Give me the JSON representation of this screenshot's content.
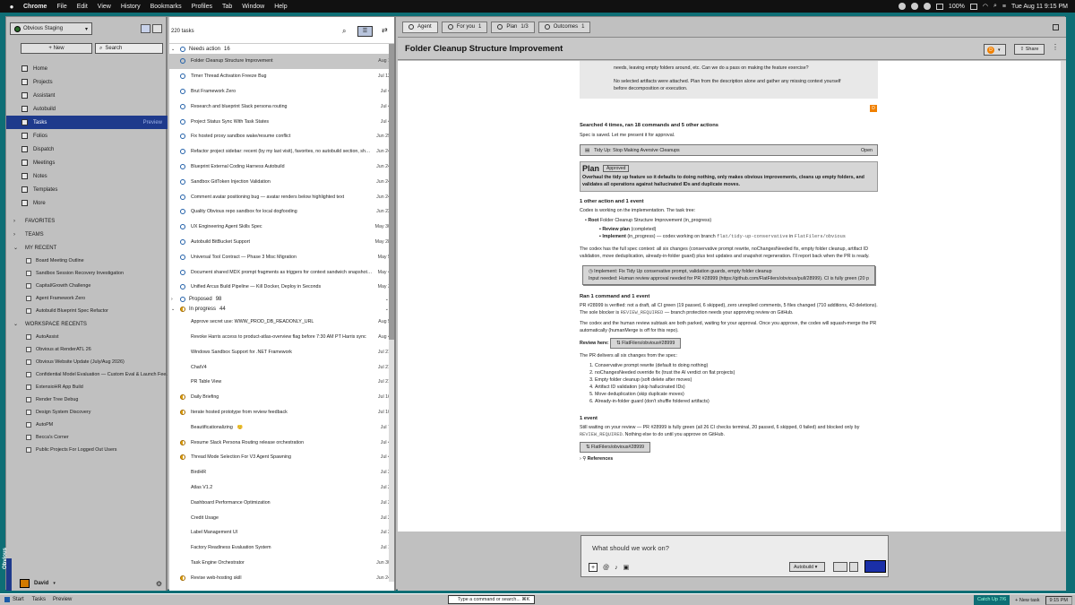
{
  "menubar": {
    "app": "Chrome",
    "items": [
      "File",
      "Edit",
      "View",
      "History",
      "Bookmarks",
      "Profiles",
      "Tab",
      "Window",
      "Help"
    ],
    "battery": "100%",
    "clock": "Tue Aug 11  9:15 PM"
  },
  "sidebar": {
    "workspace": "Obvious Staging",
    "new_label": "New",
    "search_label": "Search",
    "nav": [
      {
        "label": "Home"
      },
      {
        "label": "Projects"
      },
      {
        "label": "Assistant"
      },
      {
        "label": "Autobuild"
      },
      {
        "label": "Tasks",
        "tag": "Preview"
      },
      {
        "label": "Folios"
      },
      {
        "label": "Dispatch"
      },
      {
        "label": "Meetings"
      },
      {
        "label": "Notes"
      },
      {
        "label": "Templates"
      },
      {
        "label": "More"
      }
    ],
    "favorites": "FAVORITES",
    "teams": "TEAMS",
    "my_recent": "MY RECENT",
    "recent": [
      "Board Meeting Outline",
      "Sandbox Session Recovery Investigation",
      "Capital/Growth Challenge",
      "Agent Framework Zero",
      "Autobuild Blueprint Spec Refactor"
    ],
    "workspace_recents": "WORKSPACE RECENTS",
    "ws_recent": [
      "AutoAssist",
      "Obvious at RenderATL 26",
      "Obvious Website Update (July/Aug 2026)",
      "Confidential Model Evaluation — Custom Eval & Launch Fee...",
      "ExtensioHR App Build",
      "Render Tree Debug",
      "Design System Discovery",
      "AutoPM",
      "Becca's Corner",
      "Public Projects For Logged Out Users"
    ],
    "user": "David",
    "vertical_label": "Obvious"
  },
  "tasks": {
    "count": "220 tasks",
    "filter": "☰",
    "needs_action": {
      "label": "Needs action",
      "count": "16"
    },
    "na_rows": [
      {
        "t": "Folder Cleanup Structure Improvement",
        "d": "Aug 1"
      },
      {
        "t": "Timer Thread Activation Freeze Bug",
        "d": "Jul 12"
      },
      {
        "t": "Brut Framework Zero",
        "d": "Jul 4"
      },
      {
        "t": "Research and blueprint Slack persona routing",
        "d": "Jul 4"
      },
      {
        "t": "Project Status Sync With Task States",
        "d": "Jul 4"
      },
      {
        "t": "Fix hosted proxy sandbox wake/resume conflict",
        "d": "Jun 29"
      },
      {
        "t": "Refactor project sidebar: recent (by my last visit), favorites, no autobuild section, show...",
        "d": "Jun 24"
      },
      {
        "t": "Blueprint External Coding Harness Autobuild",
        "d": "Jun 24"
      },
      {
        "t": "Sandbox GitToken Injection Validation",
        "d": "Jun 24"
      },
      {
        "t": "Comment avatar positioning bug — avatar renders below highlighted text",
        "d": "Jun 24"
      },
      {
        "t": "Quality Obvious repo sandbox for local dogfooding",
        "d": "Jun 23"
      },
      {
        "t": "UX Engineering Agent Skills Spec",
        "d": "May 30"
      },
      {
        "t": "Autobuild BitBucket Support",
        "d": "May 28"
      },
      {
        "t": "Universal Tool Contract — Phase 3 Misc Migration",
        "d": "May 5"
      },
      {
        "t": "Document shared MDX prompt fragments as triggers for context sandwich snapshotr...",
        "d": "May 4"
      },
      {
        "t": "Unified Arcus Build Pipeline — Kill Docker, Deploy in Seconds",
        "d": "May 3"
      }
    ],
    "proposed": {
      "label": "Proposed",
      "count": "98"
    },
    "in_progress": {
      "label": "In progress",
      "count": "44"
    },
    "ip_rows": [
      {
        "t": "Approve secret use: WWW_PROD_DB_READONLY_URL",
        "d": "Aug 5",
        "s": "none"
      },
      {
        "t": "Revoke Harris access to product-atlas-overview flag before 7:30 AM PT Harris sync",
        "d": "Aug 4",
        "s": "none"
      },
      {
        "t": "Windows Sandbox Support for .NET Framework",
        "d": "Jul 21",
        "s": "none"
      },
      {
        "t": "ChatV4",
        "d": "Jul 21",
        "s": "none"
      },
      {
        "t": "PR Table View",
        "d": "Jul 21",
        "s": "none"
      },
      {
        "t": "Daily Briefing",
        "d": "Jul 16",
        "s": "ip"
      },
      {
        "t": "Iterate hosted prototype from review feedback",
        "d": "Jul 10",
        "s": "ip"
      },
      {
        "t": "Beautificationalizing",
        "d": "Jul 7",
        "s": "none",
        "emoji": "😊"
      },
      {
        "t": "Resume Slack Persona Routing release orchestration",
        "d": "Jul 4",
        "s": "ip"
      },
      {
        "t": "Thread Mode Selection For V3 Agent Spawning",
        "d": "Jul 4",
        "s": "ip"
      },
      {
        "t": "BirdHR",
        "d": "Jul 2",
        "s": "none"
      },
      {
        "t": "Atlas V1.2",
        "d": "Jul 2",
        "s": "none"
      },
      {
        "t": "Dashboard Performance Optimization",
        "d": "Jul 2",
        "s": "none"
      },
      {
        "t": "Credit Usage",
        "d": "Jul 2",
        "s": "none"
      },
      {
        "t": "Label Management UI",
        "d": "Jul 2",
        "s": "none"
      },
      {
        "t": "Factory Readiness Evaluation System",
        "d": "Jul 1",
        "s": "none"
      },
      {
        "t": "Task Engine Orchestrator",
        "d": "Jun 30",
        "s": "none"
      },
      {
        "t": "Revise web-hosting skill",
        "d": "Jun 24",
        "s": "ip"
      }
    ]
  },
  "main": {
    "tabs": [
      {
        "label": "Agent",
        "n": ""
      },
      {
        "label": "For you",
        "n": "1"
      },
      {
        "label": "Plan",
        "n": "1/3"
      },
      {
        "label": "Outcomes",
        "n": "1"
      }
    ],
    "title": "Folder Cleanup Structure Improvement",
    "share": "Share",
    "owner_initial": "D",
    "note1": "needs, leaving empty folders around, etc. Can we do a pass on making the feature exercise?",
    "note2": "No selected artifacts were attached. Plan from the description alone and gather any missing context yourself before decomposition or execution.",
    "badge": "D",
    "searched": "Searched 4 times, ran 18 commands and 5 other actions",
    "spec_saved": "Spec is saved. Let me present it for approval.",
    "spec_box": "Tidy Up: Stop Making Aversive Cleanups",
    "open": "Open",
    "plan_label": "Plan",
    "approved": "Approved",
    "plan_text": "Overhaul the tidy up feature so it defaults to doing nothing, only makes obvious improvements, cleans up empty folders, and validates all operations against hallucinated IDs and duplicate moves.",
    "ev1": "1 other action and 1 event",
    "codex": "Codex is working on the implementation. The task tree:",
    "root": "Root",
    "root_rest": "Folder Cleanup Structure Improvement (in_progress)",
    "review": "Review plan",
    "review_rest": "(completed)",
    "impl": "Implement",
    "impl_rest": "(in_progress) — codex working on branch",
    "branch": "flat/tidy-up-conservative",
    "in": "in",
    "repo": "FlatFilers/obvious",
    "p1": "The codex has the full spec context: all six changes (conservative prompt rewrite, noChangesNeeded fix, empty folder cleanup, artifact ID validation, move deduplication, already-in-folder guard) plus test updates and snapshot regeneration. I'll report back when the PR is ready.",
    "implbox1": "Implement: Fix Tidy Up conservative prompt, validation guards, empty folder cleanup",
    "implbox2": "Input needed: Human review approval needed for PR #28999 (https://github.com/FlatFilers/obvious/pull/28999). CI is fully green (20 passed...",
    "ran": "Ran 1 command and 1 event",
    "p2a": "PR #28999 is verified: not a draft, all CI green (19 passed, 6 skipped), zero unreplied comments, 5 files changed (710 additions, 43 deletions). The sole blocker is",
    "req": "REVIEW_REQUIRED",
    "p2b": "— branch protection needs your approving review on GitHub.",
    "p3": "The codex and the human review subtask are both parked, waiting for your approval. Once you approve, the codex will squash-merge the PR automatically (humanMerge is off for this repo).",
    "rh": "Review here:",
    "rlink": "FlatFilers/obvious#28999",
    "p4": "The PR delivers all six changes from the spec:",
    "ol": [
      "Conservative prompt rewrite (default to doing nothing)",
      "noChangesNeeded override fix (trust the AI verdict on flat projects)",
      "Empty folder cleanup (soft delete after moves)",
      "Artifact ID validation (skip hallucinated IDs)",
      "Move deduplication (skip duplicate moves)",
      "Already-in-folder guard (don't shuffle foldered artifacts)"
    ],
    "ev2": "1 event",
    "p5a": "Still waiting on your review — PR #28999 is fully green (all 26 CI checks terminal, 20 passed, 6 skipped, 0 failed) and blocked only by",
    "p5b": ". Nothing else to do until you approve on GitHub.",
    "link2": "FlatFilers/obvious#28999",
    "refs": "References",
    "composer": {
      "placeholder": "What should we work on?",
      "mode": "Autobuild"
    }
  },
  "taskbar": {
    "start": "Start",
    "tasks": "Tasks",
    "preview": "Preview",
    "cmd": "Type a command or search...  ⌘K",
    "catchup": "Catch Up",
    "catchup_n": "7/6",
    "newtask": "+ New task",
    "time": "9:15 PM"
  }
}
